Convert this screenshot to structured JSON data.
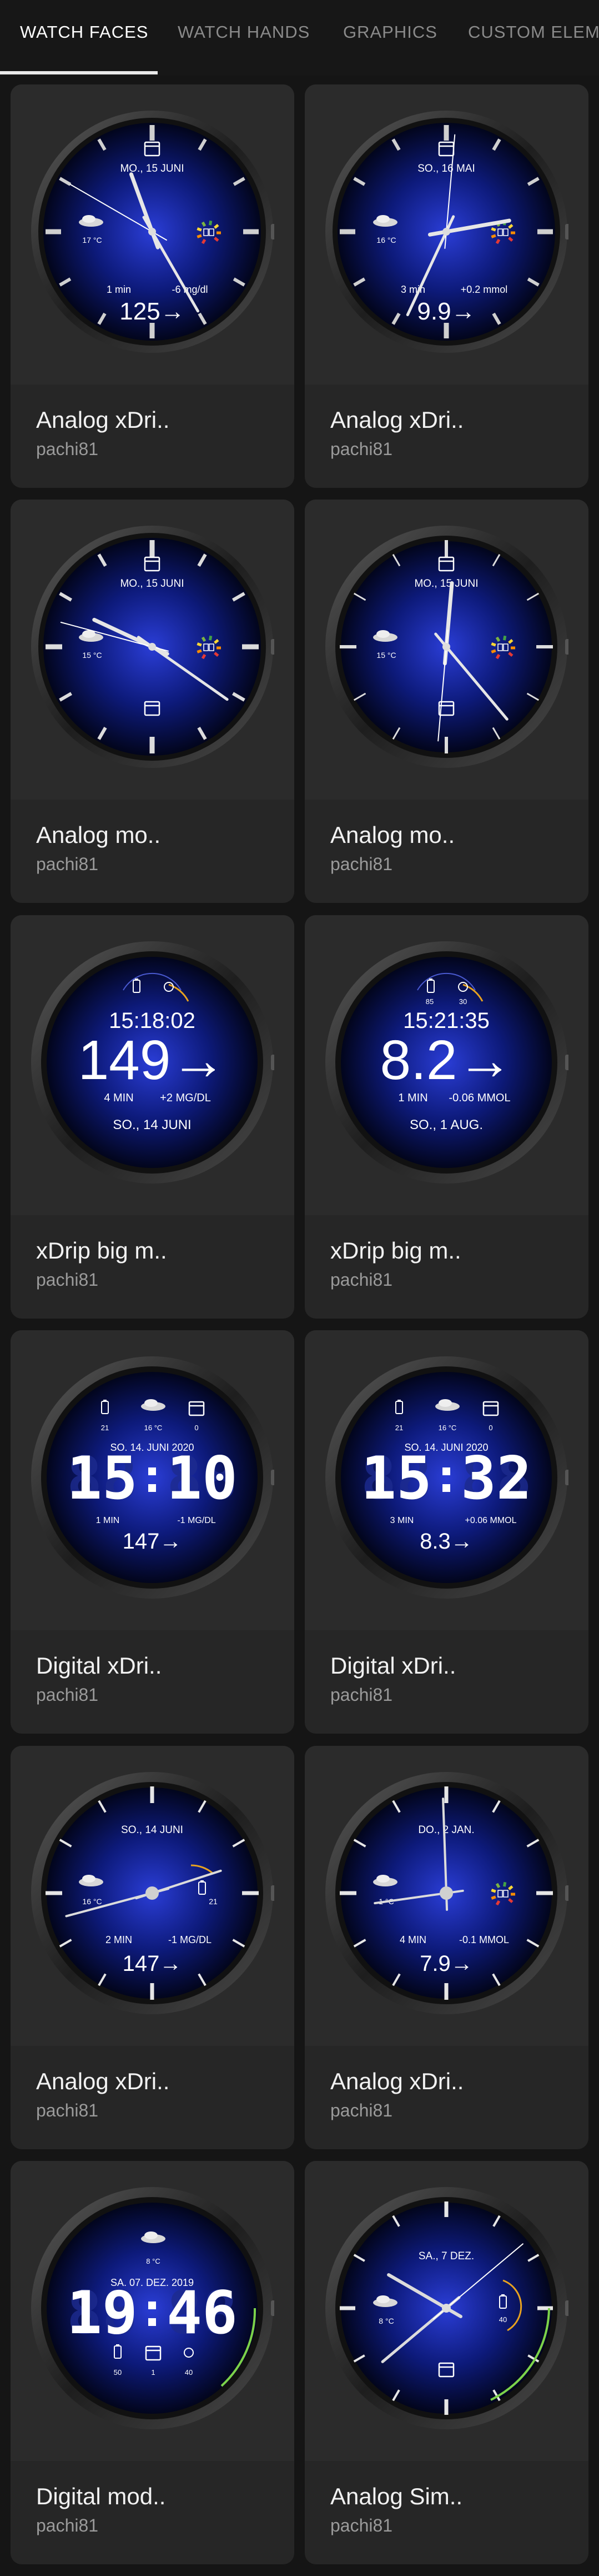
{
  "tabs": [
    {
      "label": "WATCH FACES",
      "active": true
    },
    {
      "label": "WATCH HANDS",
      "active": false
    },
    {
      "label": "GRAPHICS",
      "active": false
    },
    {
      "label": "CUSTOM ELEME",
      "active": false
    }
  ],
  "cards": [
    {
      "title": "Analog xDri..",
      "author": "pachi81",
      "face": {
        "date": "MO., 15 JUNI",
        "temp": "17 °C",
        "left": "1 min",
        "right": "-6 mg/dl",
        "value": "125→",
        "value_color": "#3fbf3f"
      }
    },
    {
      "title": "Analog xDri..",
      "author": "pachi81",
      "face": {
        "date": "SO., 16 MAI",
        "temp": "16 °C",
        "left": "3 min",
        "right": "+0.2 mmol",
        "value": "9.9→",
        "value_color": "#e8c21f"
      }
    },
    {
      "title": "Analog mo..",
      "author": "pachi81",
      "face": {
        "date": "MO., 15 JUNI",
        "temp": "15 °C"
      }
    },
    {
      "title": "Analog mo..",
      "author": "pachi81",
      "face": {
        "date": "MO., 15 JUNI",
        "temp": "15 °C"
      }
    },
    {
      "title": "xDrip big m..",
      "author": "pachi81",
      "face": {
        "time": "15:18:02",
        "value": "149→",
        "left": "4 MIN",
        "right": "+2 MG/DL",
        "date": "SO., 14 JUNI",
        "value_color": "#3fbf3f"
      }
    },
    {
      "title": "xDrip big m..",
      "author": "pachi81",
      "face": {
        "time": "15:21:35",
        "value": "8.2→",
        "left": "1 MIN",
        "right": "-0.06 MMOL",
        "date": "SO., 1 AUG.",
        "value_color": "#3fbf3f",
        "top_left": "85",
        "top_right": "30"
      }
    },
    {
      "title": "Digital xDri..",
      "author": "pachi81",
      "face": {
        "date": "SO. 14. JUNI 2020",
        "hour": "15",
        "minute": "10",
        "left": "1 MIN",
        "right": "-1 MG/DL",
        "value": "147→",
        "value_color": "#3fbf3f",
        "top_left": "21",
        "top_mid": "16 °C",
        "top_right": "0"
      }
    },
    {
      "title": "Digital xDri..",
      "author": "pachi81",
      "face": {
        "date": "SO. 14. JUNI 2020",
        "hour": "15",
        "minute": "32",
        "left": "3 MIN",
        "right": "+0.06 MMOL",
        "value": "8.3→",
        "value_color": "#3fbf3f",
        "top_left": "21",
        "top_mid": "16 °C",
        "top_right": "0"
      }
    },
    {
      "title": "Analog xDri..",
      "author": "pachi81",
      "face": {
        "date": "SO., 14 JUNI",
        "temp": "16 °C",
        "left": "2 MIN",
        "right": "-1 MG/DL",
        "value": "147→",
        "value_color": "#3fbf3f",
        "side": "21"
      }
    },
    {
      "title": "Analog xDri..",
      "author": "pachi81",
      "face": {
        "date": "DO., 2 JAN.",
        "temp": "1 °C",
        "left": "4 MIN",
        "right": "-0.1 MMOL",
        "value": "7.9→",
        "value_color": "#3fbf3f"
      }
    },
    {
      "title": "Digital mod..",
      "author": "pachi81",
      "face": {
        "temp": "8 °C",
        "date": "SA. 07. DEZ. 2019",
        "hour": "19",
        "minute": "46",
        "bottom_left": "50",
        "bottom_mid": "1",
        "bottom_right": "40"
      }
    },
    {
      "title": "Analog Sim..",
      "author": "pachi81",
      "face": {
        "date": "SA., 7 DEZ.",
        "temp": "8 °C",
        "side": "40"
      }
    }
  ]
}
